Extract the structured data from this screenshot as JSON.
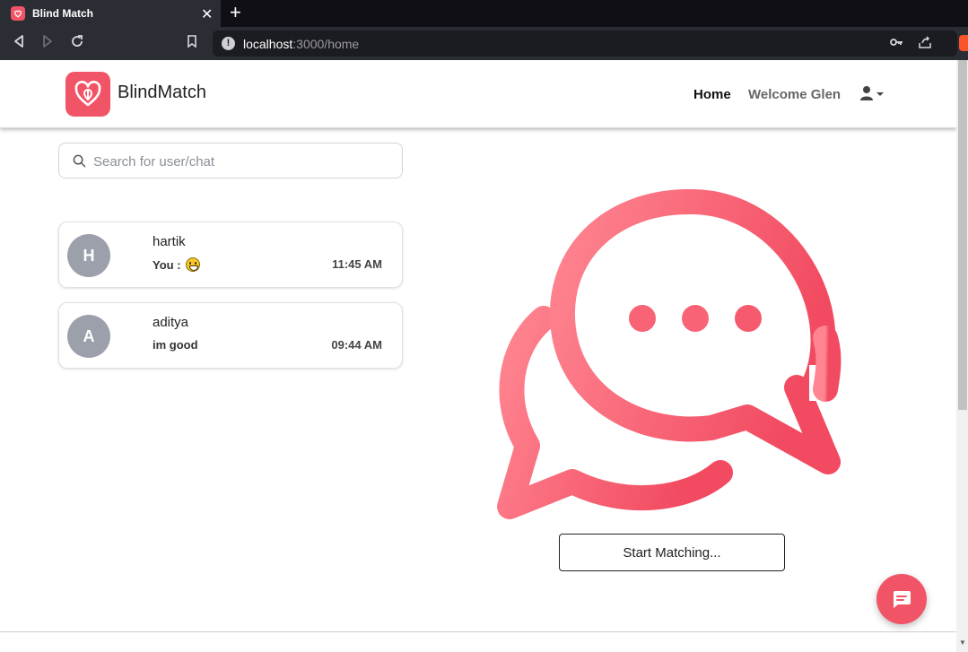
{
  "browser": {
    "tab_title": "Blind Match",
    "tab_close": "✕",
    "new_tab": "+",
    "url_host": "localhost",
    "url_rest": ":3000/home"
  },
  "navbar": {
    "brand": "BlindMatch",
    "home": "Home",
    "welcome": "Welcome Glen"
  },
  "search": {
    "placeholder": "Search for user/chat"
  },
  "chats": [
    {
      "initial": "H",
      "name": "hartik",
      "last_message": "You :",
      "time": "11:45 AM",
      "has_emoji": true
    },
    {
      "initial": "A",
      "name": "aditya",
      "last_message": "im good",
      "time": "09:44 AM",
      "has_emoji": false
    }
  ],
  "hero": {
    "start_button": "Start Matching..."
  },
  "colors": {
    "brand": "#f25467",
    "brand_light": "#ff8591"
  },
  "icons": {
    "fab": "chat-bubble-icon",
    "user_menu": "user-icon"
  }
}
